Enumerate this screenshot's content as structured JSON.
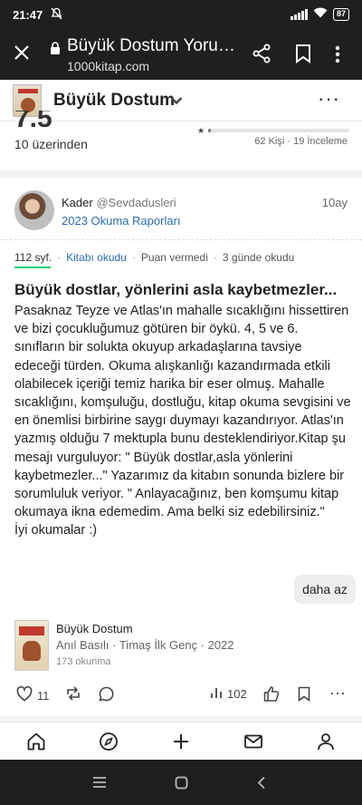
{
  "status_bar": {
    "time": "21:47",
    "battery": "87"
  },
  "browser": {
    "title": "Büyük Dostum Yoru…",
    "url": "1000kitap.com"
  },
  "book_header": {
    "title": "Büyük Dostum"
  },
  "rating": {
    "score_partial": "7.5",
    "out_of": "10 üzerinden",
    "distribution_fill": 0.02,
    "stats": "62 Kişi · 19 İnceleme"
  },
  "review": {
    "user_name": "Kader",
    "user_handle": "@Sevdadusleri",
    "time_ago": "10ay",
    "report_link": "2023 Okuma Raporları",
    "meta": {
      "pages": "112 syf.",
      "read_state": "Kitabı okudu",
      "rating_state": "Puan vermedi",
      "duration": "3 günde okudu"
    },
    "title": "Büyük dostlar, yönlerini asla kaybetmezler...",
    "body_main": "Pasaknaz Teyze ve Atlas'ın mahalle sıcaklığını hissettiren ve bizi çocukluğumuz götüren bir öykü.  4, 5 ve 6. sınıfların bir solukta okuyup arkadaşlarına tavsiye edeceği türden.  Okuma alışkanlığı kazandırmada etkili olabilecek içeriği   temiz harika bir eser olmuş. Mahalle sıcaklığını,  komşuluğu,  dostluğu, kitap okuma sevgisini ve en önemlisi birbirine saygı duymayı kazandırıyor. Atlas'ın yazmış olduğu 7 mektupla bunu desteklendiriyor.Kitap şu mesajı vurguluyor: \" Büyük dostlar,asla yönlerini kaybetmezler...\" Yazarımız da kitabın sonunda bizlere bir sorumluluk veriyor. \" Anlayacağınız, ben komşumu kitap okumaya ikna edemedim. Ama belki siz edebilirsiniz.\"",
    "body_closing": "İyi okumalar :)",
    "more_label": "daha az"
  },
  "book_card": {
    "title": "Büyük Dostum",
    "author_publisher_year": "Anıl Basılı · Timaş İlk Genç · 2022",
    "reads": "173 okunma"
  },
  "actions": {
    "likes": "11",
    "views": "102"
  },
  "icons": {
    "close": "close-icon",
    "lock": "lock-icon",
    "share": "share-icon",
    "bookmark": "bookmark-icon",
    "more": "more-vert-icon",
    "chevron": "chevron-down-icon",
    "heart": "heart-icon",
    "repost": "repost-icon",
    "comment": "comment-icon",
    "views": "bar-chart-icon",
    "like": "thumbs-up-icon",
    "save": "bookmark-icon",
    "home": "home-icon",
    "explore": "compass-icon",
    "add": "plus-icon",
    "messages": "mail-icon",
    "profile": "user-icon"
  },
  "colors": {
    "accent_link": "#2b6cb0",
    "progress_green": "#2ecc71",
    "system_bar": "#1f1f1f"
  }
}
